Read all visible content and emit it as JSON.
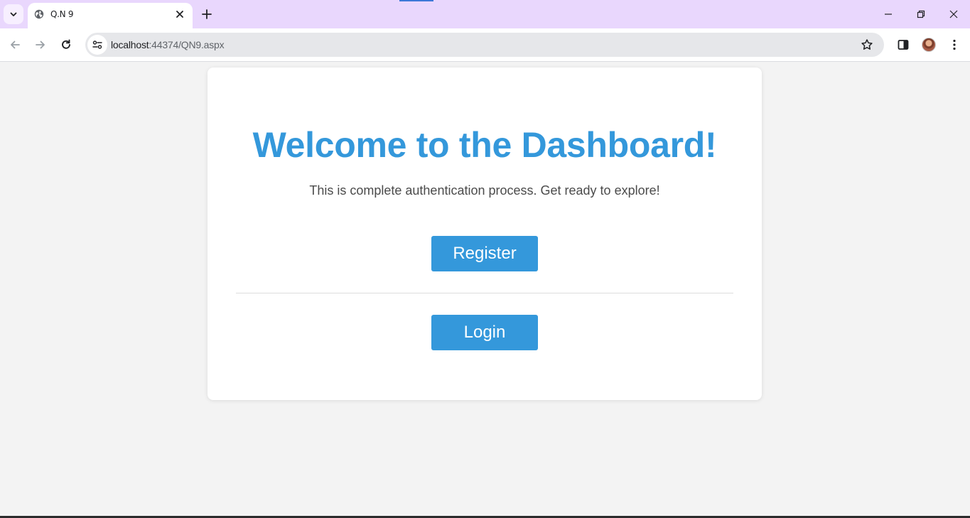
{
  "browser": {
    "tab": {
      "title": "Q.N 9"
    },
    "address": {
      "host": "localhost",
      "path": ":44374/QN9.aspx"
    }
  },
  "page": {
    "heading": "Welcome to the Dashboard!",
    "subtext": "This is complete authentication process. Get ready to explore!",
    "register_label": "Register",
    "login_label": "Login"
  },
  "colors": {
    "accent": "#3498db",
    "frame": "#e9d7fd",
    "page_bg": "#f3f3f3"
  },
  "icons": [
    "tab-search-icon",
    "globe-icon",
    "close-icon",
    "plus-icon",
    "minimize-icon",
    "restore-icon",
    "window-close-icon",
    "back-arrow-icon",
    "forward-arrow-icon",
    "reload-icon",
    "site-info-icon",
    "star-icon",
    "side-panel-icon",
    "profile-avatar",
    "more-menu-icon"
  ]
}
